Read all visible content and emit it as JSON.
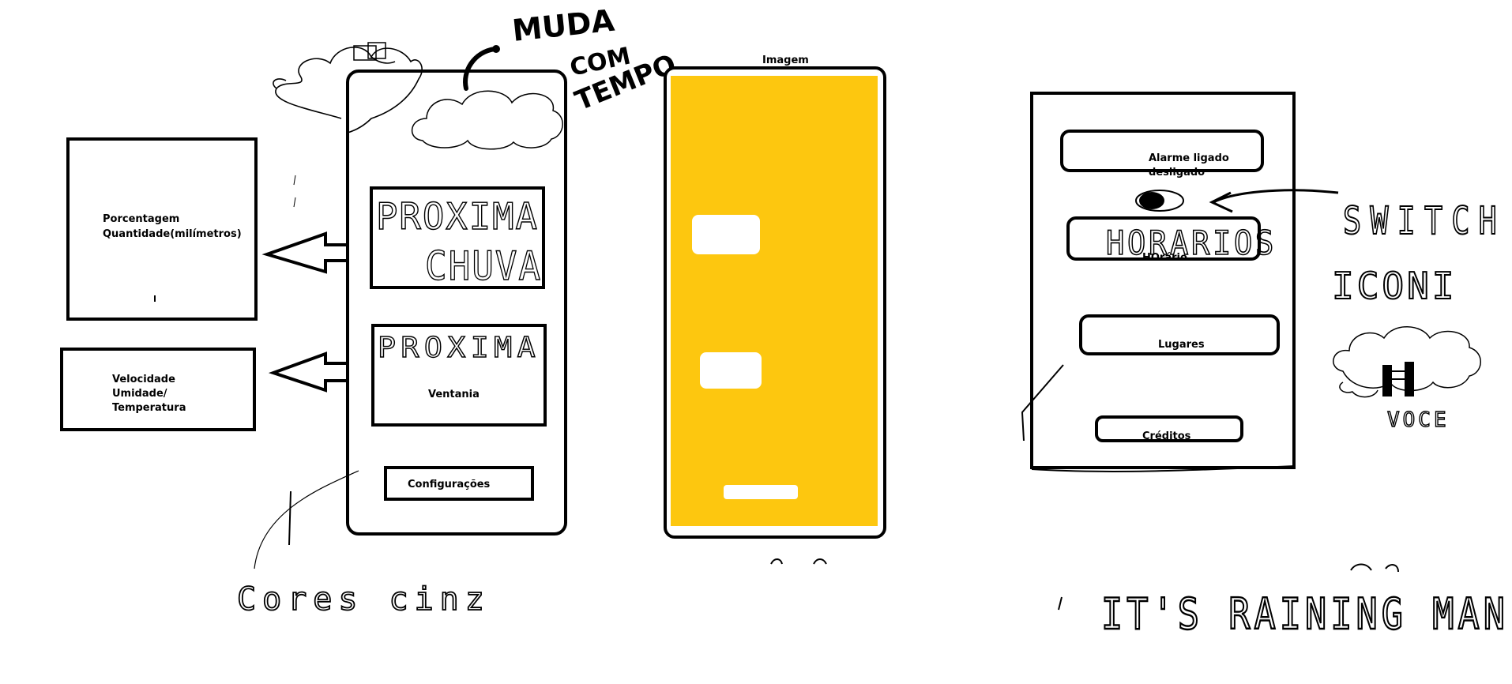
{
  "left_panels": {
    "rain_info": [
      "Porcentagem",
      "Quantidade(milímetros)"
    ],
    "wind_info": [
      "Velocidade",
      "Umidade/",
      "Temperatura"
    ]
  },
  "main_screen": {
    "weather_note": [
      "MUDA",
      "COM",
      "TEMPO"
    ],
    "next_rain_button": [
      "PROXIMA",
      "CHUVA"
    ],
    "next_wind_button": "PROXIMA",
    "next_wind_label": "Ventania",
    "settings_button": "Configurações",
    "bottom_note": "Cores cinz"
  },
  "image_screen": {
    "title": "Imagem",
    "background_color": "#fdc70f"
  },
  "settings_screen": {
    "alarm_label": "Alarme ligado",
    "alarm_sub": "desligado",
    "schedules_handwritten": "HORARIOS",
    "schedules_label": "HOrário",
    "places_label": "Lugares",
    "credits_label": "Créditos",
    "switch_note": "SWITCH",
    "icon_note": "ICONI",
    "icon_caption": "VOCE",
    "bottom_note": "IT'S RAINING MAN"
  }
}
